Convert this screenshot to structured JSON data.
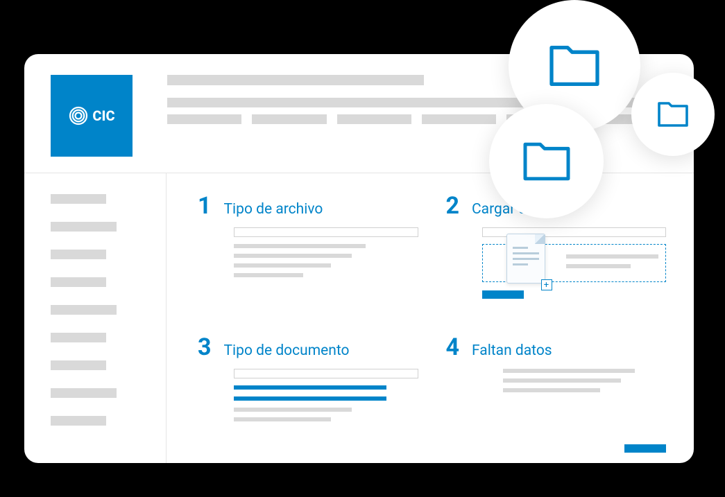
{
  "logo": {
    "text": "CIC"
  },
  "steps": {
    "s1": {
      "number": "1",
      "title": "Tipo de archivo"
    },
    "s2": {
      "number": "2",
      "title": "Cargar archivo"
    },
    "s3": {
      "number": "3",
      "title": "Tipo de documento"
    },
    "s4": {
      "number": "4",
      "title": "Faltan datos"
    }
  },
  "colors": {
    "primary": "#0084c9",
    "placeholder": "#d9d9d9"
  }
}
